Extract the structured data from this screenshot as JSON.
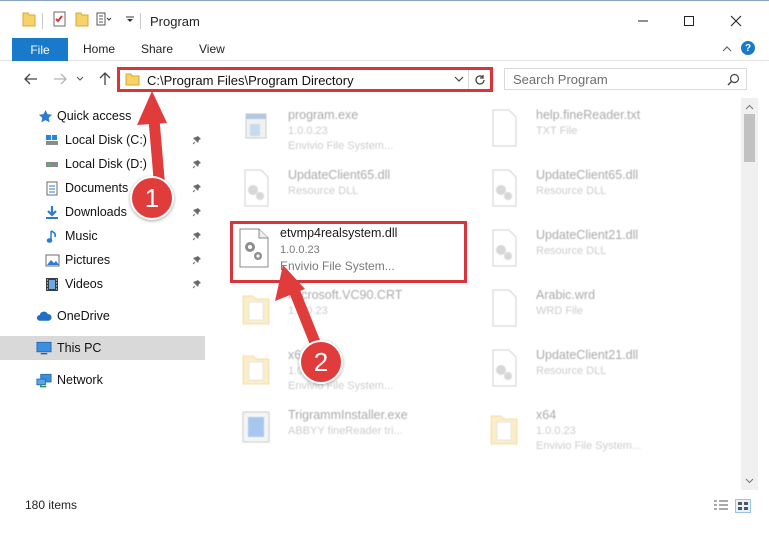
{
  "window": {
    "title": "Program",
    "minimize_glyph": "—",
    "maximize_glyph": "☐",
    "close_glyph": "✕"
  },
  "ribbon": {
    "file_label": "File",
    "tabs": [
      {
        "label": "Home"
      },
      {
        "label": "Share"
      },
      {
        "label": "View"
      }
    ]
  },
  "address": {
    "path": "C:\\Program Files\\Program Directory"
  },
  "search": {
    "placeholder": "Search Program"
  },
  "sidebar": {
    "items": [
      {
        "label": "Quick access",
        "icon": "star-icon"
      },
      {
        "label": "Local Disk (C:)",
        "icon": "drive-icon",
        "pinned": true
      },
      {
        "label": "Local Disk (D:)",
        "icon": "drive-icon",
        "pinned": true
      },
      {
        "label": "Documents",
        "icon": "documents-icon",
        "pinned": true
      },
      {
        "label": "Downloads",
        "icon": "downloads-icon",
        "pinned": true
      },
      {
        "label": "Music",
        "icon": "music-icon",
        "pinned": true
      },
      {
        "label": "Pictures",
        "icon": "pictures-icon",
        "pinned": true
      },
      {
        "label": "Videos",
        "icon": "videos-icon",
        "pinned": true
      },
      {
        "label": "OneDrive",
        "icon": "cloud-icon"
      },
      {
        "label": "This PC",
        "icon": "computer-icon",
        "selected": true
      },
      {
        "label": "Network",
        "icon": "network-icon"
      }
    ]
  },
  "files": [
    {
      "name": "program.exe",
      "line2": "1.0.0.23",
      "line3": "Envivio File System...",
      "icon": "exe-icon"
    },
    {
      "name": "help.fineReader.txt",
      "line2": "TXT File",
      "line3": "",
      "icon": "txt-icon"
    },
    {
      "name": "UpdateClient65.dll",
      "line2": "Resource DLL",
      "line3": "",
      "icon": "dll-icon"
    },
    {
      "name": "UpdateClient65.dll",
      "line2": "Resource DLL",
      "line3": "",
      "icon": "dll-icon"
    },
    {
      "name": "etvmp4realsystem.dll",
      "line2": "1.0.0.23",
      "line3": "Envivio File System...",
      "icon": "dll-icon",
      "highlight": true
    },
    {
      "name": "UpdateClient21.dll",
      "line2": "Resource DLL",
      "line3": "",
      "icon": "dll-icon"
    },
    {
      "name": "Microsoft.VC90.CRT",
      "line2": "1.0.0.23",
      "line3": "",
      "icon": "folder-icon"
    },
    {
      "name": "Arabic.wrd",
      "line2": "WRD File",
      "line3": "",
      "icon": "txt-icon"
    },
    {
      "name": "x64",
      "line2": "1.0.0.23",
      "line3": "Envivio File System...",
      "icon": "folder-icon"
    },
    {
      "name": "UpdateClient21.dll",
      "line2": "Resource DLL",
      "line3": "",
      "icon": "dll-icon"
    },
    {
      "name": "TrigrammInstaller.exe",
      "line2": "ABBYY fineReader tri...",
      "line3": "",
      "icon": "installer-icon"
    },
    {
      "name": "x64",
      "line2": "1.0.0.23",
      "line3": "Envivio File System...",
      "icon": "folder-icon"
    }
  ],
  "status": {
    "item_count": "180 items"
  },
  "annotations": {
    "step1": "1",
    "step2": "2"
  },
  "colors": {
    "accent": "#1979ca",
    "highlight_red": "#d9343a",
    "badge_red": "#e03c3c",
    "selected_bg": "#d9d9d9"
  }
}
